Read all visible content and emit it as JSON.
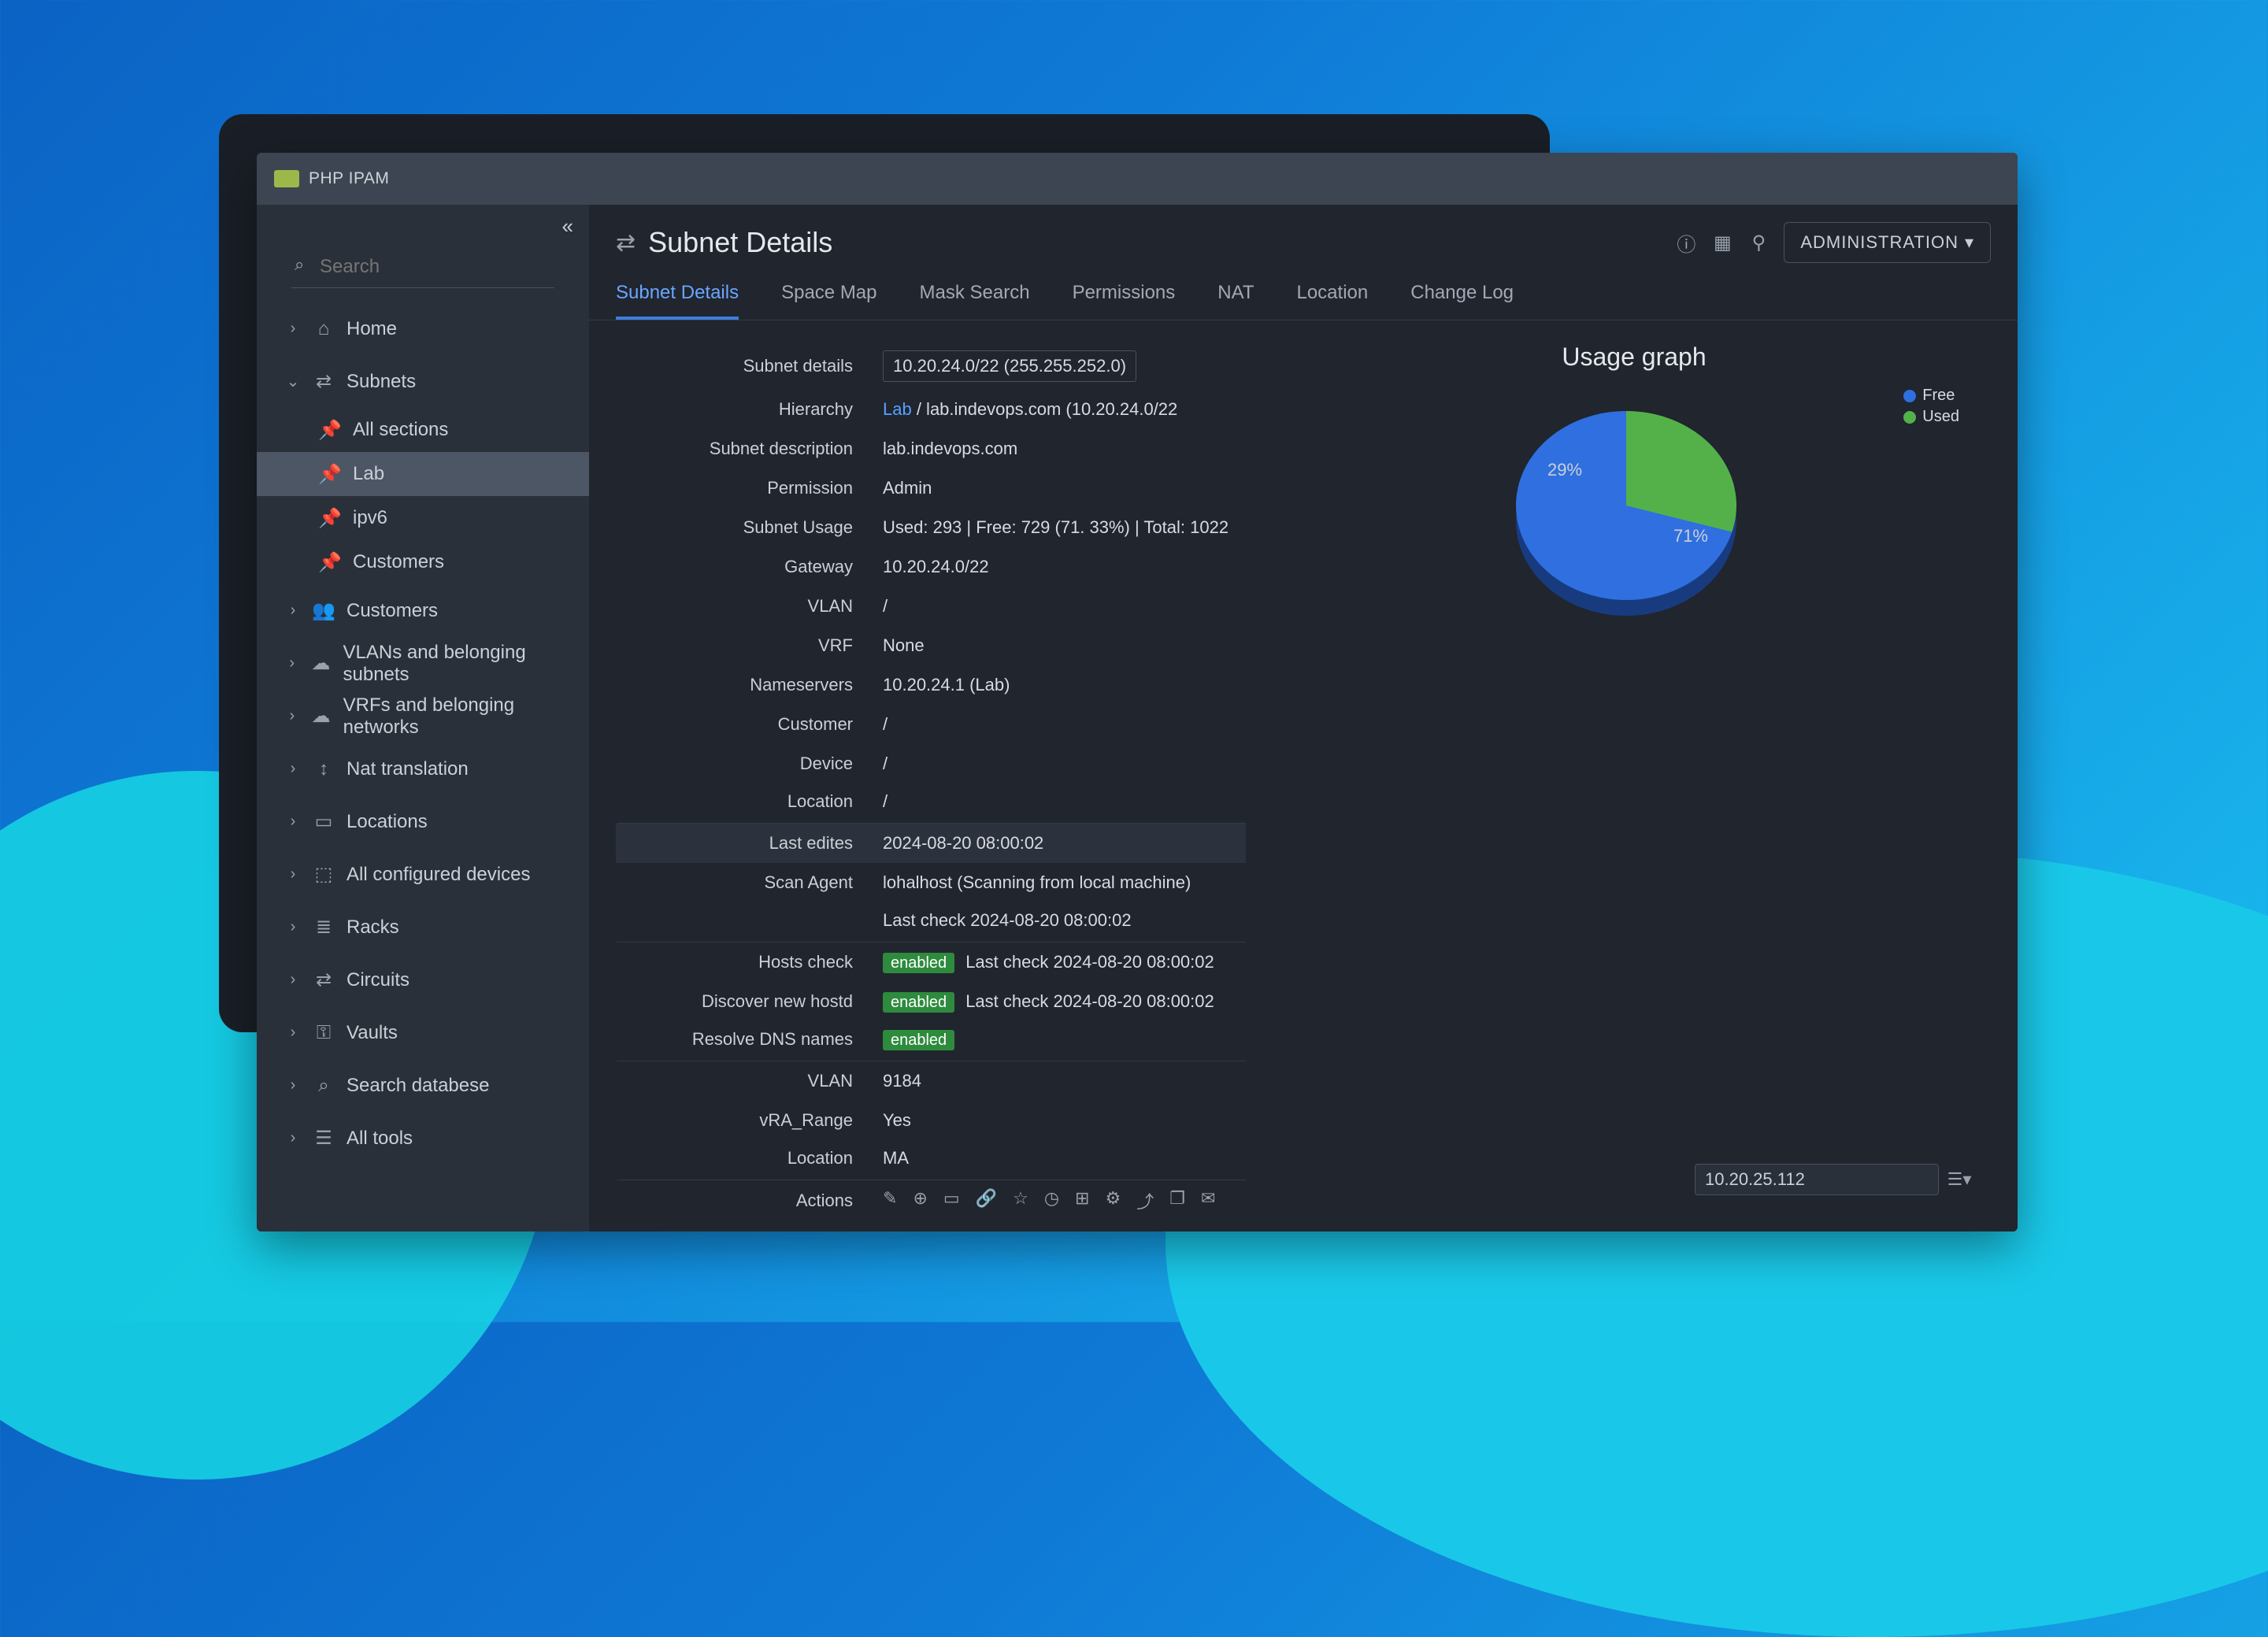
{
  "app_name": "PHP IPAM",
  "search_placeholder": "Search",
  "sidebar": {
    "items": [
      {
        "label": "Home",
        "sub": false
      },
      {
        "label": "Subnets",
        "sub": false,
        "expanded": true
      },
      {
        "label": "All sections",
        "sub": true
      },
      {
        "label": "Lab",
        "sub": true,
        "active": true
      },
      {
        "label": "ipv6",
        "sub": true
      },
      {
        "label": "Customers",
        "sub": true
      },
      {
        "label": "Customers",
        "sub": false
      },
      {
        "label": "VLANs and belonging subnets",
        "sub": false
      },
      {
        "label": "VRFs and belonging networks",
        "sub": false
      },
      {
        "label": "Nat translation",
        "sub": false
      },
      {
        "label": "Locations",
        "sub": false
      },
      {
        "label": "All configured devices",
        "sub": false
      },
      {
        "label": "Racks",
        "sub": false
      },
      {
        "label": "Circuits",
        "sub": false
      },
      {
        "label": "Vaults",
        "sub": false
      },
      {
        "label": "Search databese",
        "sub": false
      },
      {
        "label": "All tools",
        "sub": false
      }
    ]
  },
  "header": {
    "title": "Subnet Details",
    "admin_label": "ADMINISTRATION"
  },
  "tabs": [
    "Subnet Details",
    "Space Map",
    "Mask Search",
    "Permissions",
    "NAT",
    "Location",
    "Change Log"
  ],
  "active_tab": 0,
  "details": [
    {
      "label": "Subnet details",
      "value": "10.20.24.0/22 (255.255.252.0)",
      "boxed": true
    },
    {
      "label": "Hierarchy",
      "value_html": true,
      "link": "Lab",
      "sep": "/",
      "rest": "lab.indevops.com (10.20.24.0/22"
    },
    {
      "label": "Subnet description",
      "value": "lab.indevops.com"
    },
    {
      "label": "Permission",
      "value": "Admin"
    },
    {
      "label": "Subnet Usage",
      "value": "Used: 293 | Free: 729  (71. 33%) | Total: 1022"
    },
    {
      "label": "Gateway",
      "value": "10.20.24.0/22"
    },
    {
      "label": "VLAN",
      "value": "/"
    },
    {
      "label": "VRF",
      "value": "None"
    },
    {
      "label": "Nameservers",
      "value": "10.20.24.1 (Lab)"
    },
    {
      "label": "Customer",
      "value": "/"
    },
    {
      "label": "Device",
      "value": "/"
    },
    {
      "label": "Location",
      "value": "/"
    },
    {
      "label": "Last edites",
      "value": "2024-08-20 08:00:02",
      "hilite": true
    },
    {
      "label": "Scan Agent",
      "value": "lohalhost (Scanning from local machine)"
    },
    {
      "label": "",
      "value": "Last check 2024-08-20 08:00:02"
    },
    {
      "label": "Hosts check",
      "badge": "enabled",
      "value": "Last check 2024-08-20 08:00:02"
    },
    {
      "label": "Discover new hostd",
      "badge": "enabled",
      "value": "Last check 2024-08-20 08:00:02"
    },
    {
      "label": "Resolve DNS names",
      "badge": "enabled",
      "value": ""
    },
    {
      "label": "VLAN",
      "value": "9184"
    },
    {
      "label": "vRA_Range",
      "value": "Yes"
    },
    {
      "label": "Location",
      "value": "MA"
    },
    {
      "label": "Actions",
      "actions": true
    }
  ],
  "action_icons": [
    "pencil-icon",
    "plus-circle-icon",
    "card-icon",
    "link-icon",
    "star-icon",
    "clock-icon",
    "add-square-icon",
    "gear-icon",
    "export-icon",
    "window-icon",
    "mail-icon"
  ],
  "ip_field": "10.20.25.112",
  "chart_data": {
    "type": "pie",
    "title": "Usage graph",
    "series": [
      {
        "name": "Free",
        "value": 71,
        "color": "#2f6fe0"
      },
      {
        "name": "Used",
        "value": 29,
        "color": "#54b14a"
      }
    ],
    "labels": {
      "free_pct": "71%",
      "used_pct": "29%"
    }
  },
  "legend": [
    {
      "label": "Free",
      "color": "#2f6fe0"
    },
    {
      "label": "Used",
      "color": "#54b14a"
    }
  ]
}
